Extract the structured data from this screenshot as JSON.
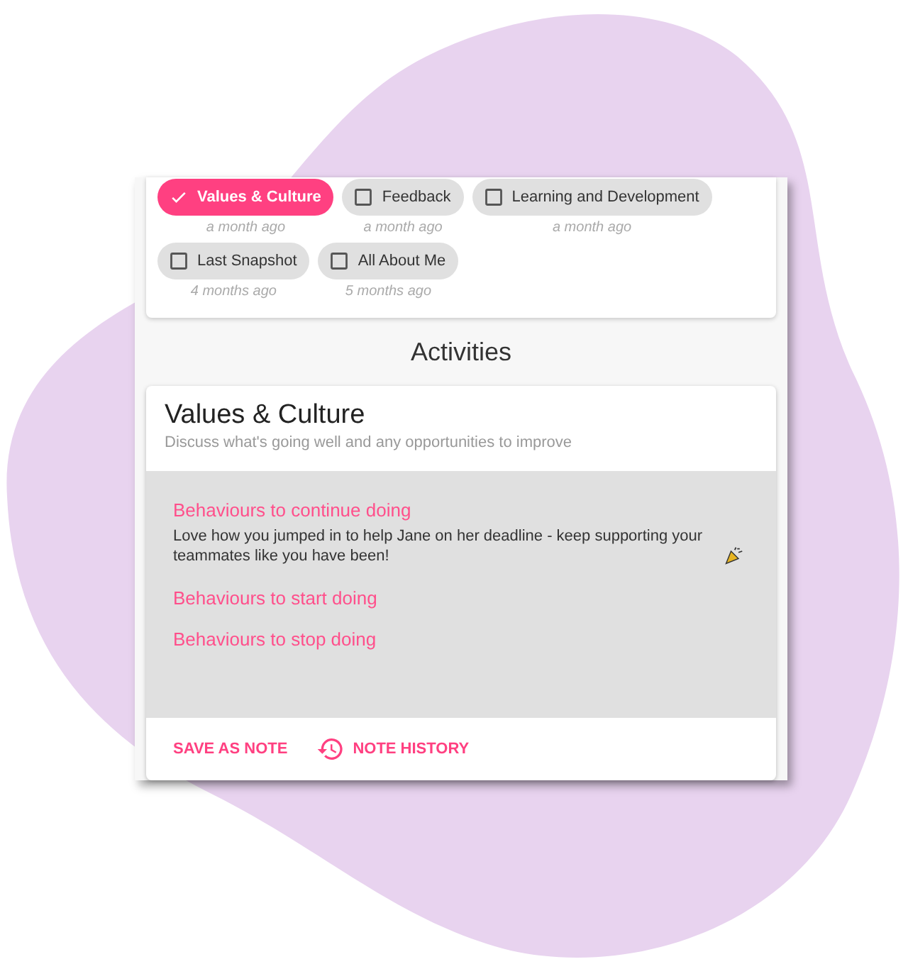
{
  "topics": [
    {
      "label": "Values & Culture",
      "selected": true,
      "time": "a month ago"
    },
    {
      "label": "Feedback",
      "selected": false,
      "time": "a month ago"
    },
    {
      "label": "Learning and Development",
      "selected": false,
      "time": "a month ago"
    },
    {
      "label": "Last Snapshot",
      "selected": false,
      "time": "4 months ago"
    },
    {
      "label": "All About Me",
      "selected": false,
      "time": "5 months ago"
    }
  ],
  "section_title": "Activities",
  "card": {
    "title": "Values & Culture",
    "subtitle": "Discuss what's going well and any opportunities to improve",
    "prompts": [
      {
        "heading": "Behaviours to continue doing",
        "note": "Love how you jumped in to help Jane on her deadline - keep supporting your teammates like you have been!"
      },
      {
        "heading": "Behaviours to start doing"
      },
      {
        "heading": "Behaviours to stop doing"
      }
    ],
    "actions": [
      {
        "label": "SAVE AS NOTE",
        "kind": "plain"
      },
      {
        "label": "NOTE HISTORY",
        "kind": "history"
      }
    ]
  }
}
